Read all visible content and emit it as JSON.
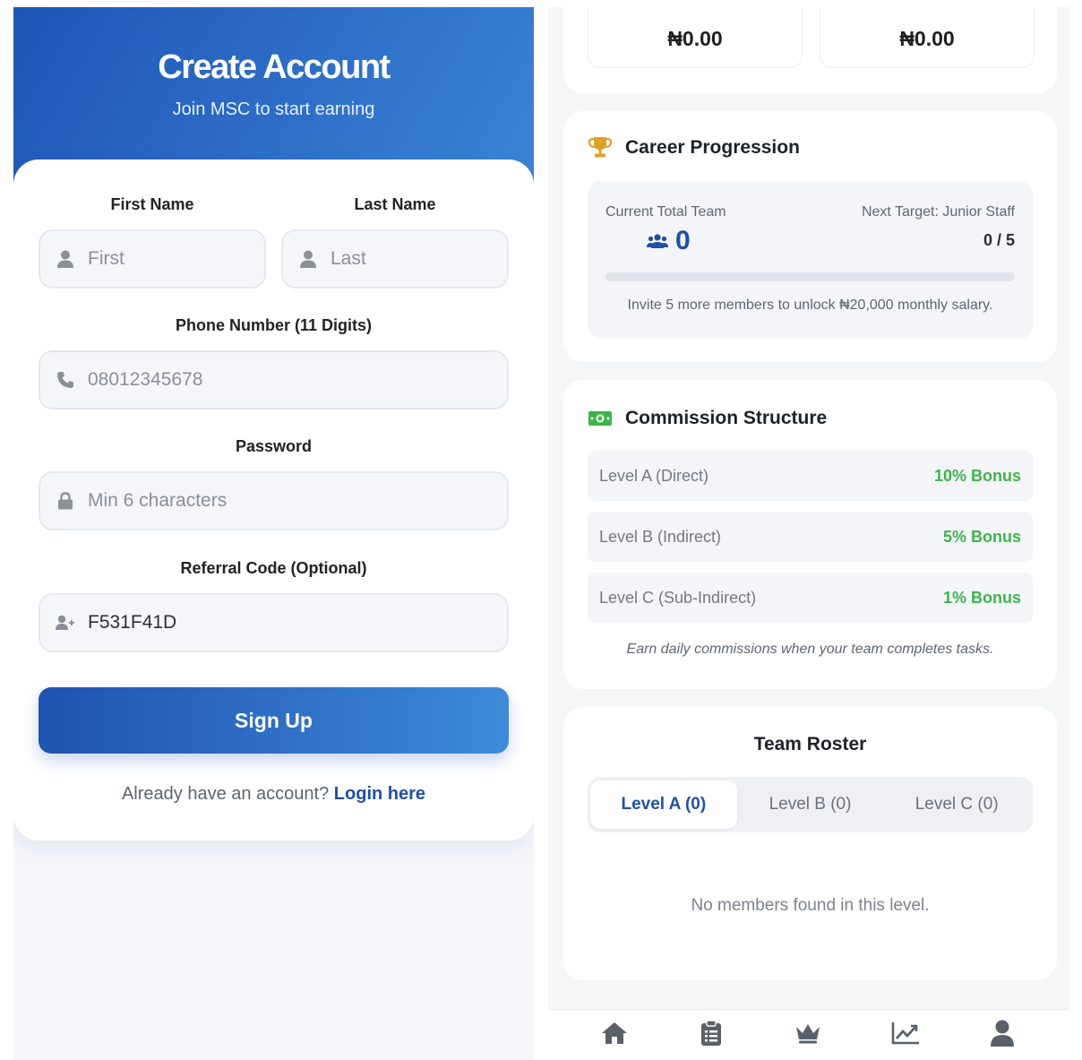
{
  "signup": {
    "title": "Create Account",
    "subtitle": "Join MSC to start earning",
    "first_name_label": "First Name",
    "last_name_label": "Last Name",
    "first_placeholder": "First",
    "last_placeholder": "Last",
    "phone_label": "Phone Number (11 Digits)",
    "phone_placeholder": "08012345678",
    "password_label": "Password",
    "password_placeholder": "Min 6 characters",
    "referral_label": "Referral Code (Optional)",
    "referral_value": "F531F41D",
    "signup_button": "Sign Up",
    "login_prompt": "Already have an account?",
    "login_link": "Login here"
  },
  "dashboard": {
    "stats": [
      {
        "value": "₦0.00"
      },
      {
        "value": "₦0.00"
      }
    ],
    "career": {
      "title": "Career Progression",
      "team_label": "Current Total Team",
      "team_count": "0",
      "target_label": "Next Target: Junior Staff",
      "target_progress": "0 / 5",
      "progress_fraction": 0,
      "invite_text": "Invite 5 more members to unlock ₦20,000 monthly salary."
    },
    "commission": {
      "title": "Commission Structure",
      "rows": [
        {
          "name": "Level A (Direct)",
          "bonus": "10% Bonus"
        },
        {
          "name": "Level B (Indirect)",
          "bonus": "5% Bonus"
        },
        {
          "name": "Level C (Sub-Indirect)",
          "bonus": "1% Bonus"
        }
      ],
      "note": "Earn daily commissions when your team completes tasks."
    },
    "roster": {
      "title": "Team Roster",
      "tabs": [
        {
          "label": "Level A (0)",
          "active": true
        },
        {
          "label": "Level B (0)",
          "active": false
        },
        {
          "label": "Level C (0)",
          "active": false
        }
      ],
      "empty_text": "No members found in this level."
    },
    "nav": [
      {
        "icon": "home-icon"
      },
      {
        "icon": "clipboard-icon"
      },
      {
        "icon": "crown-icon"
      },
      {
        "icon": "chart-line-icon"
      },
      {
        "icon": "user-icon"
      }
    ]
  },
  "colors": {
    "primary": "#1f4fa8",
    "gradient_start": "#1e55b8",
    "gradient_end": "#3b86d6",
    "bonus_green": "#3bb54a",
    "trophy_gold": "#e0a224"
  }
}
